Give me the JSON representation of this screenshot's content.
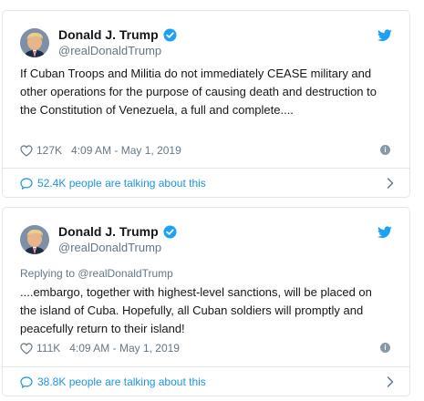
{
  "tweets": [
    {
      "display_name": "Donald J. Trump",
      "handle": "@realDonaldTrump",
      "reply_to": "",
      "text": "If Cuban Troops and Militia do not immediately CEASE military and other operations for the purpose of causing death and destruction to the Constitution of Venezuela, a full and complete....",
      "likes": "127K",
      "timestamp": "4:09 AM - May 1, 2019",
      "talking": "52.4K people are talking about this",
      "icons": [
        "avatar",
        "verified-icon",
        "twitter-bird-icon",
        "heart-icon",
        "info-icon",
        "speech-bubble-icon",
        "chevron-right-icon"
      ]
    },
    {
      "display_name": "Donald J. Trump",
      "handle": "@realDonaldTrump",
      "reply_to": "Replying to @realDonaldTrump",
      "text": "....embargo, together with highest-level sanctions, will be placed on the island of Cuba. Hopefully, all Cuban soldiers will promptly and peacefully return to their island!",
      "likes": "111K",
      "timestamp": "4:09 AM - May 1, 2019",
      "talking": "38.8K people are talking about this",
      "icons": [
        "avatar",
        "verified-icon",
        "twitter-bird-icon",
        "heart-icon",
        "info-icon",
        "speech-bubble-icon",
        "chevron-right-icon"
      ]
    }
  ],
  "colors": {
    "text": "#14171a",
    "secondary": "#657786",
    "link": "#1b95e0",
    "verified": "#1da1f2",
    "border": "#e1e8ed"
  }
}
